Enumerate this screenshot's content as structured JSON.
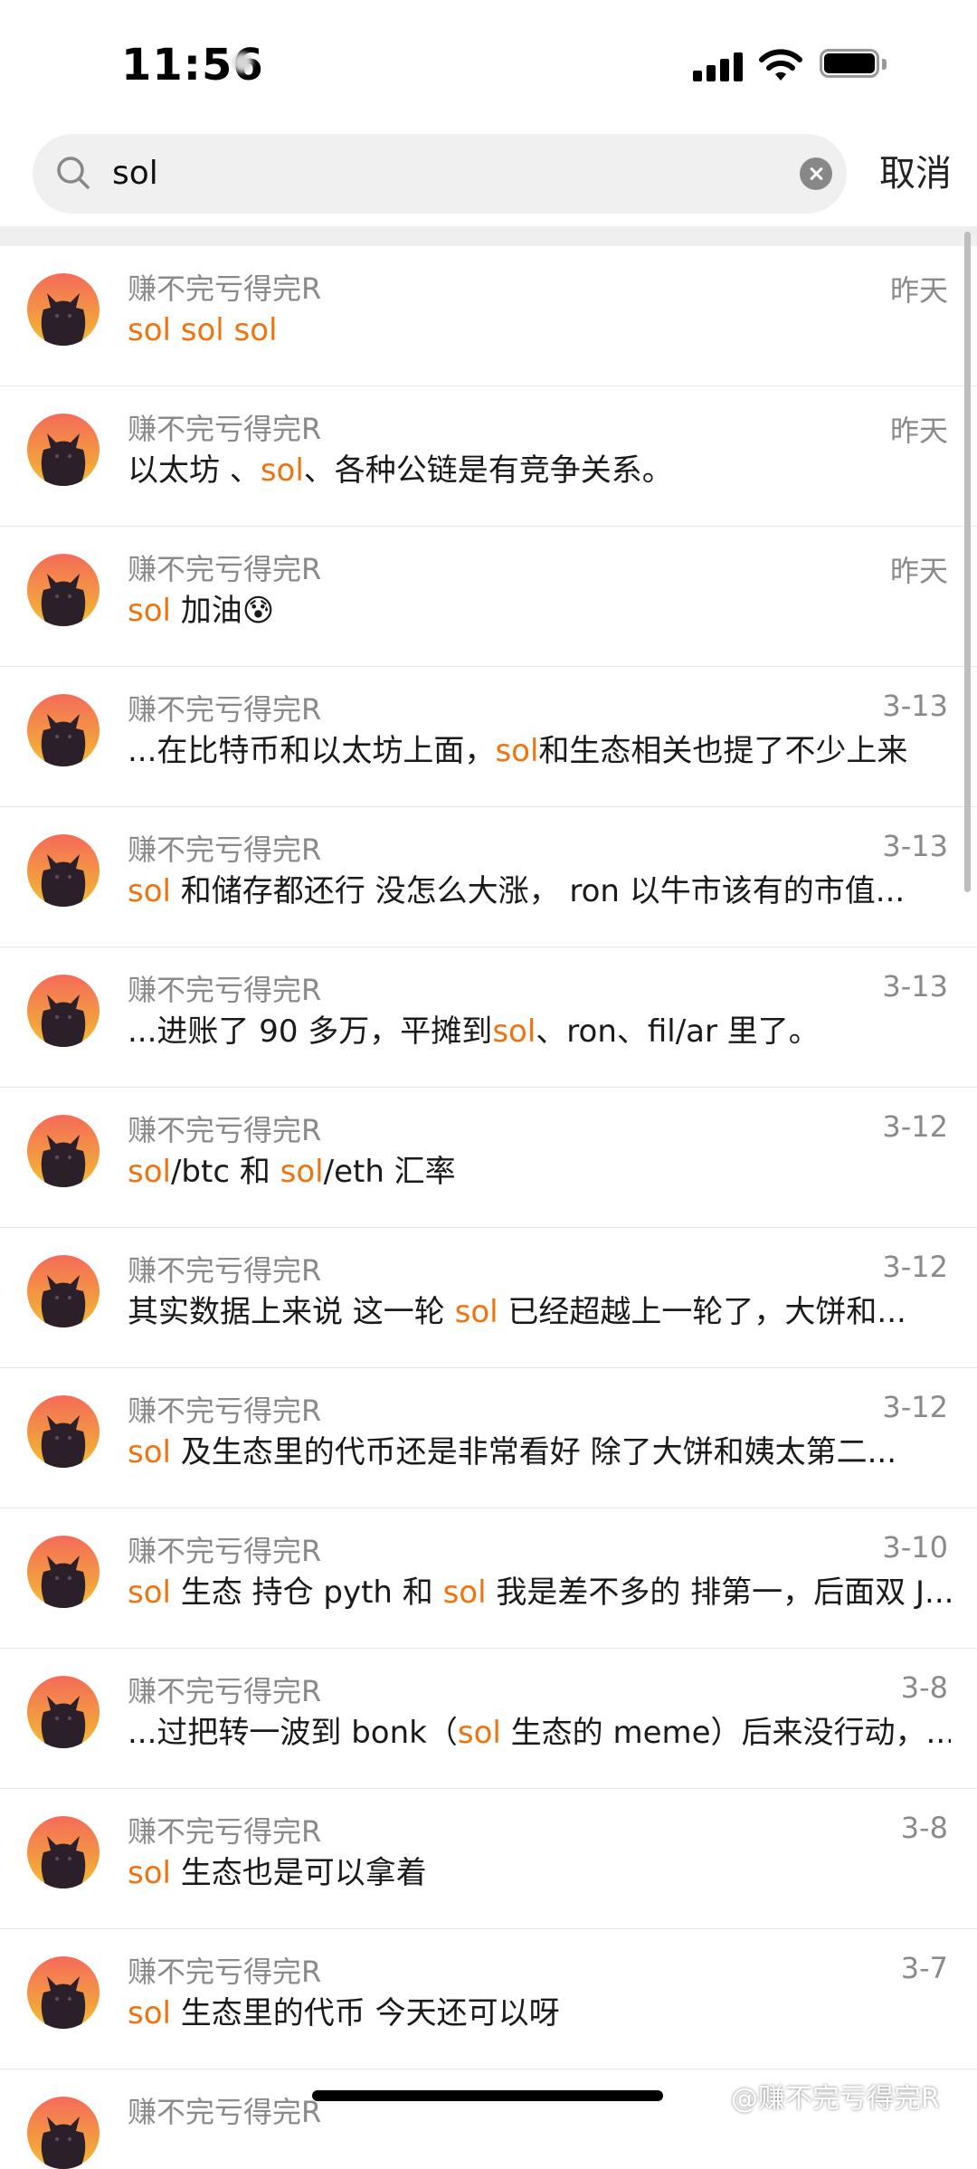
{
  "status_bar": {
    "time": "11:56"
  },
  "search": {
    "query": "sol",
    "cancel_label": "取消"
  },
  "results": [
    {
      "name": "赚不完亏得完R",
      "date": "昨天",
      "parts": [
        {
          "t": "sol sol sol",
          "hl": true
        }
      ]
    },
    {
      "name": "赚不完亏得完R",
      "date": "昨天",
      "parts": [
        {
          "t": "以太坊 、",
          "hl": false
        },
        {
          "t": "sol",
          "hl": true
        },
        {
          "t": "、各种公链是有竞争关系。",
          "hl": false
        }
      ]
    },
    {
      "name": "赚不完亏得完R",
      "date": "昨天",
      "parts": [
        {
          "t": "sol",
          "hl": true
        },
        {
          "t": " 加油😰",
          "hl": false
        }
      ]
    },
    {
      "name": "赚不完亏得完R",
      "date": "3-13",
      "parts": [
        {
          "t": "...在比特币和以太坊上面，",
          "hl": false
        },
        {
          "t": "sol",
          "hl": true
        },
        {
          "t": "和生态相关也提了不少上来",
          "hl": false
        }
      ]
    },
    {
      "name": "赚不完亏得完R",
      "date": "3-13",
      "parts": [
        {
          "t": "sol",
          "hl": true
        },
        {
          "t": " 和储存都还行 没怎么大涨， ron 以牛市该有的市值...",
          "hl": false
        }
      ]
    },
    {
      "name": "赚不完亏得完R",
      "date": "3-13",
      "parts": [
        {
          "t": "...进账了 90 多万，平摊到",
          "hl": false
        },
        {
          "t": "sol",
          "hl": true
        },
        {
          "t": "、ron、fil/ar 里了。",
          "hl": false
        }
      ]
    },
    {
      "name": "赚不完亏得完R",
      "date": "3-12",
      "parts": [
        {
          "t": "sol",
          "hl": true
        },
        {
          "t": "/btc 和 ",
          "hl": false
        },
        {
          "t": "sol",
          "hl": true
        },
        {
          "t": "/eth 汇率",
          "hl": false
        }
      ]
    },
    {
      "name": "赚不完亏得完R",
      "date": "3-12",
      "parts": [
        {
          "t": "其实数据上来说 这一轮 ",
          "hl": false
        },
        {
          "t": "sol",
          "hl": true
        },
        {
          "t": " 已经超越上一轮了，大饼和...",
          "hl": false
        }
      ]
    },
    {
      "name": "赚不完亏得完R",
      "date": "3-12",
      "parts": [
        {
          "t": "sol",
          "hl": true
        },
        {
          "t": " 及生态里的代币还是非常看好 除了大饼和姨太第二...",
          "hl": false
        }
      ]
    },
    {
      "name": "赚不完亏得完R",
      "date": "3-10",
      "parts": [
        {
          "t": "sol",
          "hl": true
        },
        {
          "t": " 生态 持仓 pyth 和 ",
          "hl": false
        },
        {
          "t": "sol",
          "hl": true
        },
        {
          "t": " 我是差不多的 排第一，后面双 J...",
          "hl": false
        }
      ]
    },
    {
      "name": "赚不完亏得完R",
      "date": "3-8",
      "parts": [
        {
          "t": "...过把转一波到 bonk（",
          "hl": false
        },
        {
          "t": "sol",
          "hl": true
        },
        {
          "t": " 生态的 meme）后来没行动，...",
          "hl": false
        }
      ]
    },
    {
      "name": "赚不完亏得完R",
      "date": "3-8",
      "parts": [
        {
          "t": "sol",
          "hl": true
        },
        {
          "t": " 生态也是可以拿着",
          "hl": false
        }
      ]
    },
    {
      "name": "赚不完亏得完R",
      "date": "3-7",
      "parts": [
        {
          "t": "sol",
          "hl": true
        },
        {
          "t": " 生态里的代币 今天还可以呀",
          "hl": false
        }
      ]
    }
  ],
  "partial_row": {
    "name": "赚不完亏得完R"
  },
  "watermark": "@赚不完亏得完R"
}
